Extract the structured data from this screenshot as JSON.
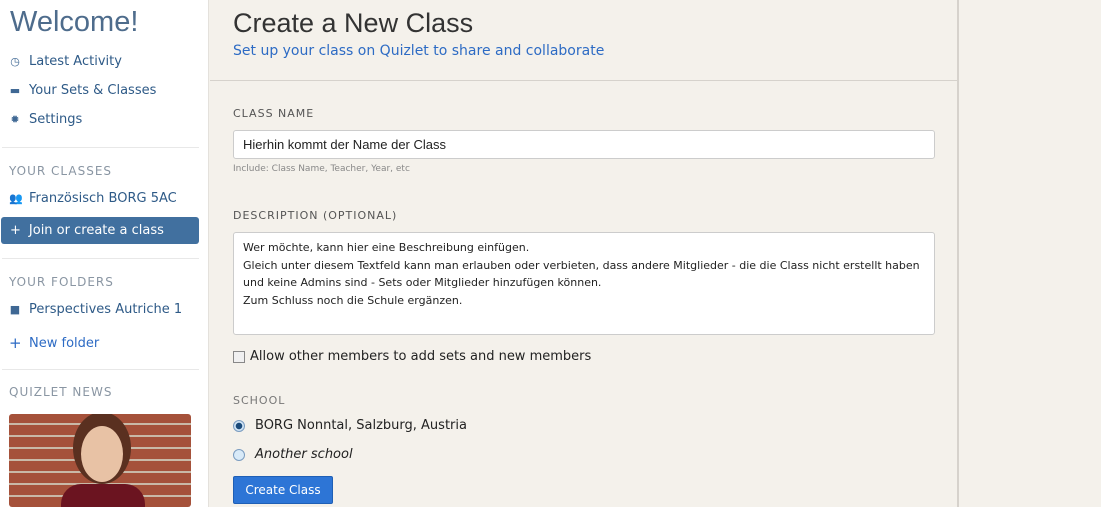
{
  "sidebar": {
    "welcome": "Welcome!",
    "nav": [
      {
        "label": "Latest Activity",
        "icon": "clock-icon"
      },
      {
        "label": "Your Sets & Classes",
        "icon": "cards-icon"
      },
      {
        "label": "Settings",
        "icon": "gear-icon"
      }
    ],
    "classes_header": "YOUR CLASSES",
    "classes": [
      {
        "label": "Französisch BORG 5AC",
        "icon": "users-icon"
      }
    ],
    "join_label": "Join or create a class",
    "folders_header": "YOUR FOLDERS",
    "folders": [
      {
        "label": "Perspectives Autriche 1",
        "icon": "folder-icon"
      }
    ],
    "new_folder": "New folder",
    "news_header": "QUIZLET NEWS"
  },
  "main": {
    "title": "Create a New Class",
    "subtitle": "Set up your class on Quizlet to share and collaborate",
    "class_name_label": "CLASS NAME",
    "class_name_value": "Hierhin kommt der Name der Class",
    "class_name_help": "Include: Class Name, Teacher, Year, etc",
    "description_label": "DESCRIPTION (OPTIONAL)",
    "description_value": "Wer möchte, kann hier eine Beschreibung einfügen.\nGleich unter diesem Textfeld kann man erlauben oder verbieten, dass andere Mitglieder - die die Class nicht erstellt haben und keine Admins sind - Sets oder Mitglieder hinzufügen können.\nZum Schluss noch die Schule ergänzen.",
    "allow_label": "Allow other members to add sets and new members",
    "allow_checked": false,
    "school_label": "SCHOOL",
    "schools": [
      {
        "label": "BORG Nonntal, Salzburg, Austria",
        "selected": true
      },
      {
        "label": "Another school",
        "selected": false
      }
    ],
    "submit": "Create Class"
  }
}
